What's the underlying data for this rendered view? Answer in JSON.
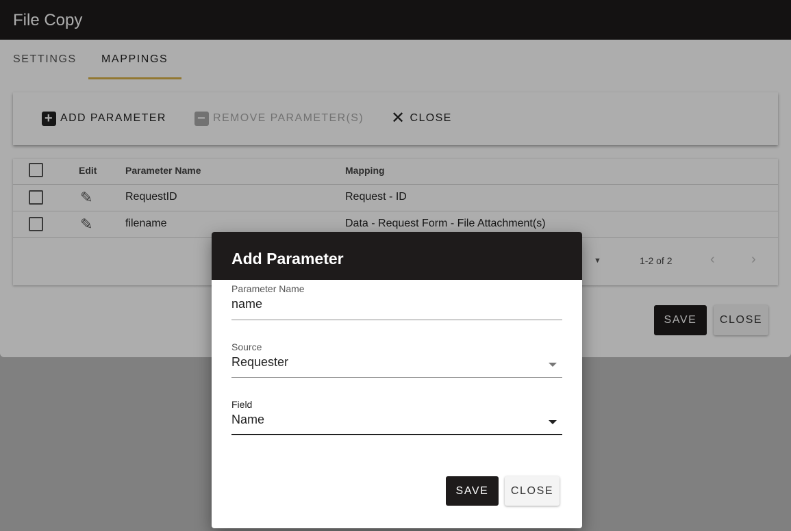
{
  "window": {
    "title": "File Copy",
    "tabs": [
      {
        "label": "SETTINGS"
      },
      {
        "label": "MAPPINGS"
      }
    ],
    "toolbar": {
      "add_label": "ADD PARAMETER",
      "remove_label": "REMOVE PARAMETER(S)",
      "close_label": "CLOSE"
    },
    "table": {
      "headers": {
        "edit": "Edit",
        "name": "Parameter Name",
        "mapping": "Mapping"
      },
      "rows": [
        {
          "name": "RequestID",
          "mapping": "Request - ID"
        },
        {
          "name": "filename",
          "mapping": "Data - Request Form - File Attachment(s)"
        }
      ],
      "pagination": "1-2 of 2"
    },
    "save_label": "SAVE",
    "close_label": "CLOSE"
  },
  "dialog": {
    "title": "Add Parameter",
    "fields": {
      "parameter_name": {
        "label": "Parameter Name",
        "value": "name"
      },
      "source": {
        "label": "Source",
        "value": "Requester"
      },
      "field": {
        "label": "Field",
        "value": "Name"
      }
    },
    "save_label": "SAVE",
    "close_label": "CLOSE"
  },
  "icons": {
    "add": "plus-square-icon",
    "remove": "minus-square-icon",
    "close": "close-icon",
    "edit": "pencil-icon"
  },
  "colors": {
    "header_bg": "#1e1b1b",
    "tab_indicator": "#d8b24a"
  }
}
